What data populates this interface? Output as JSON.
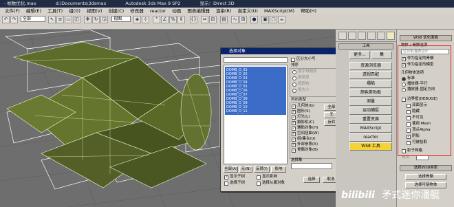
{
  "window": {
    "title_parts": [
      "- 帧数优化.max",
      "d:\\Documents\\3dsmax",
      "Autodesk 3ds Max 9 SP2",
      "显示：Direct 3D"
    ]
  },
  "menubar": {
    "items": [
      "文件(F)",
      "编辑(E)",
      "工具(T)",
      "组(G)",
      "视图(V)",
      "创建(C)",
      "修改器",
      "reactor",
      "动画",
      "图表编辑器",
      "渲染(R)",
      "自定义(U)",
      "MAXScript(M)",
      "帮助(H)"
    ]
  },
  "toolbar": {
    "filter_value": "全部",
    "coord_value": "视图"
  },
  "dialog": {
    "title": "选择对象",
    "case_label": "区分大小写",
    "sort_title": "排序",
    "sort_options": [
      "按字母顺序",
      "按类型",
      "按颜色",
      "按大小"
    ],
    "objects": [
      "DOMB_D_01",
      "DOMB_D_02",
      "DOMB_D_03",
      "DOMB_D_04",
      "DOMB_D_05",
      "DOMB_D_06",
      "DOMB_D_07",
      "DOMB_D_08",
      "DOMB_D_09",
      "DOMB_D_10",
      "DOMB_D_11"
    ],
    "types_title": "列出类型",
    "types": [
      "几何体(G)",
      "图形(S)",
      "灯光(L)",
      "摄影机(C)",
      "辅助对象(H)",
      "空间扭曲(W)",
      "组/集合(U)",
      "外部参照(X)",
      "骨骼对象(B)"
    ],
    "type_buttons": [
      "全部",
      "无",
      "反转"
    ],
    "selection_sets_title": "选择集",
    "bottom_buttons": [
      "全部(A)",
      "无(N)",
      "反转(I)",
      "影响"
    ],
    "options": [
      "显示子树",
      "选择子树",
      "显示影响",
      "选择从属对象"
    ],
    "select_button": "选择",
    "cancel_button": "取消"
  },
  "command_panel": {
    "rollout_header": "工具",
    "more_button": "更多...",
    "sets_button": "集",
    "utilities": [
      "资源浏览器",
      "透视匹配",
      "塌陷",
      "颜色剪贴板",
      "测量",
      "运动捕捉",
      "重置变换",
      "MAXScript",
      "reactor",
      "WS8 工具"
    ],
    "active_index": 9
  },
  "right_panel": {
    "title": "WS8 优化面板",
    "object_group": "物体 / 骨骼选项",
    "object_field_value": "空对象/面数合计",
    "object_options": [
      "作为指定的骨骼",
      "作为指定的模型"
    ],
    "geometry_group": "几何物体选项",
    "geometry_options": [
      "标准",
      "播放器-平行",
      "播放器-固定方向"
    ],
    "edge_group": "边界框(DEBUGE)",
    "edge_options": [
      "双面显示",
      "隐藏",
      "不可见",
      "使用 Mesh",
      "顶点Alpha",
      "阴影",
      "可被拾取"
    ],
    "extra_options": [
      "影子网格",
      "分页"
    ],
    "bottom_group": "选择WS8类型",
    "bottom_buttons": [
      "选择骨骼",
      "选择可链物体"
    ]
  },
  "watermark": {
    "site": "bilibili",
    "author": "矛式迷你潘艇"
  }
}
